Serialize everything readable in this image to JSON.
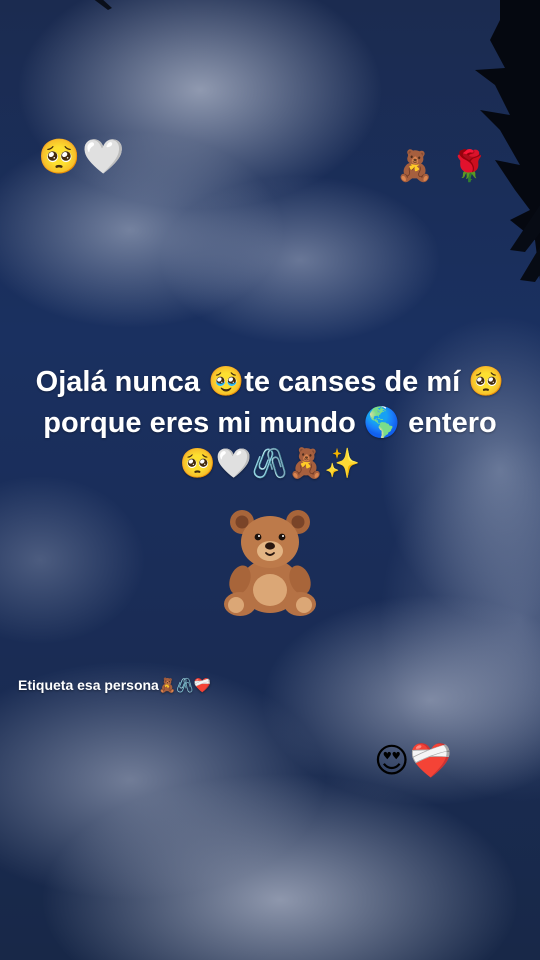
{
  "emojis": {
    "top_left": "🥺🤍",
    "top_right": "🧸 🌹",
    "bottom_right": "😍❤️‍🩹"
  },
  "main_text": {
    "line1": "Ojalá nunca 🥹te canses de mí 🥺",
    "line2": "porque eres mi mundo 🌎 entero",
    "line3": "🥺🤍🖇️🧸✨"
  },
  "big_icon": "teddy-bear",
  "tag_text": "Etiqueta esa persona🧸🖇️❤️‍🩹",
  "colors": {
    "sky": "#1a3060",
    "cloud": "#d7dce8",
    "text": "#ffffff"
  }
}
